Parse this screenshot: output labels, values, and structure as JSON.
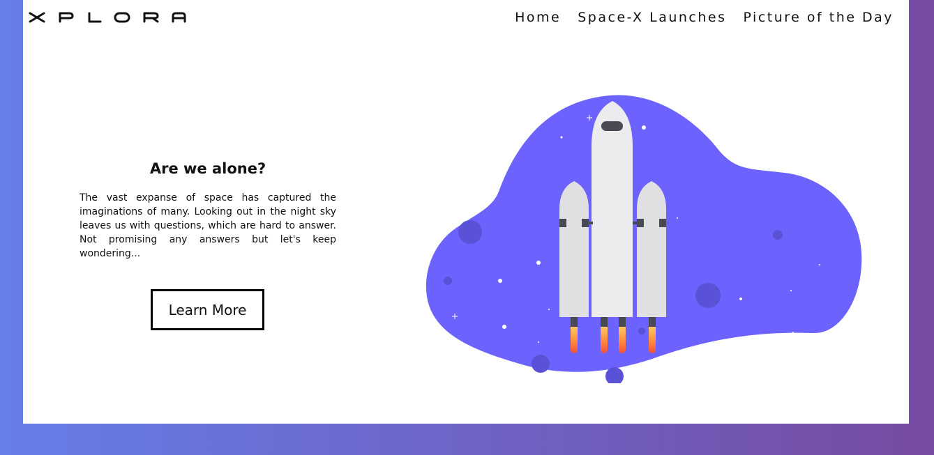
{
  "brand": {
    "logo_text": "XPLORA"
  },
  "nav": {
    "items": [
      {
        "label": "Home"
      },
      {
        "label": "Space-X Launches"
      },
      {
        "label": "Picture of the Day"
      }
    ]
  },
  "hero": {
    "title": "Are we alone?",
    "body": "The vast expanse of space has captured the imaginations of many. Looking out in the night sky leaves us with questions, which are hard to answer. Not promising any answers but let's keep wondering...",
    "cta_label": "Learn More"
  },
  "illustration": {
    "name": "rocket-illustration"
  },
  "colors": {
    "background_start": "#667eea",
    "background_end": "#764ba2",
    "blob": "#6c63ff",
    "card": "#ffffff"
  }
}
